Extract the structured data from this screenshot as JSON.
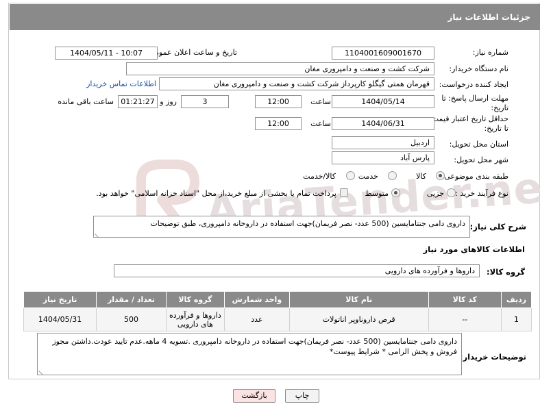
{
  "header": {
    "title": "جزئیات اطلاعات نیاز"
  },
  "form": {
    "need_number_label": "شماره نیاز:",
    "need_number": "1104001609001670",
    "announce_label": "تاریخ و ساعت اعلان عمومی:",
    "announce_value": "1404/05/11 - 10:07",
    "buyer_org_label": "نام دستگاه خریدار:",
    "buyer_org": "شرکت کشت و صنعت و دامپروری مغان",
    "creator_label": "ایجاد کننده درخواست:",
    "creator": "قهرمان همتی گیگلو کارپرداز شرکت کشت و صنعت و دامپروری مغان",
    "contact_link": "اطلاعات تماس خریدار",
    "reply_deadline_label_1": "مهلت ارسال پاسخ: تا",
    "reply_deadline_label_2": "تاریخ:",
    "reply_date": "1404/05/14",
    "time_label": "ساعت",
    "reply_time": "12:00",
    "days_value": "3",
    "days_label": "روز و",
    "remaining_time": "01:21:27",
    "remaining_label": "ساعت باقی مانده",
    "price_deadline_label_1": "حداقل تاریخ اعتبار قیمت:",
    "price_deadline_label_2": "تا تاریخ:",
    "price_date": "1404/06/31",
    "price_time": "12:00",
    "province_label": "استان محل تحویل:",
    "province": "اردبیل",
    "city_label": "شهر محل تحویل:",
    "city": "پارس آباد",
    "category_label": "طبقه بندی موضوعی:",
    "category_options": [
      "کالا",
      "خدمت",
      "کالا/خدمت"
    ],
    "process_label": "نوع فرآیند خرید :",
    "process_options": [
      "جزیی",
      "متوسط"
    ],
    "payment_note": "پرداخت تمام یا بخشی از مبلغ خرید،از محل \"اسناد خزانه اسلامی\" خواهد بود.",
    "description_label": "شرح کلی نیاز:",
    "description": "داروی دامی جنتامایسین (500 عدد- نصر فریمان)جهت استفاده در داروخانه دامپروری، طبق توضیحات"
  },
  "goods": {
    "section_title": "اطلاعات کالاهای مورد نیاز",
    "group_label": "گروه کالا:",
    "group_value": "داروها و فرآورده های دارویی",
    "columns": [
      "ردیف",
      "کد کالا",
      "نام کالا",
      "واحد شمارش",
      "گروه کالا",
      "تعداد / مقدار",
      "تاریخ نیاز"
    ],
    "rows": [
      {
        "row": "1",
        "code": "--",
        "name": "قرص داروناوپر اناتولات",
        "unit": "عدد",
        "group": "داروها و فرآورده های دارویی",
        "qty": "500",
        "date": "1404/05/31"
      }
    ]
  },
  "buyer_notes": {
    "label": "توضیحات خریدار:",
    "text": "داروی دامی جنتامایسین (500 عدد- نصر فریمان)جهت استفاده در داروخانه دامپروری .تسویه 4 ماهه.عدم تایید عودت.داشتن مجوز فروش و پخش  الزامی * شرایط پیوست*"
  },
  "buttons": {
    "print": "چاپ",
    "back": "بازگشت"
  },
  "watermark_text": "AriaTender.neT"
}
